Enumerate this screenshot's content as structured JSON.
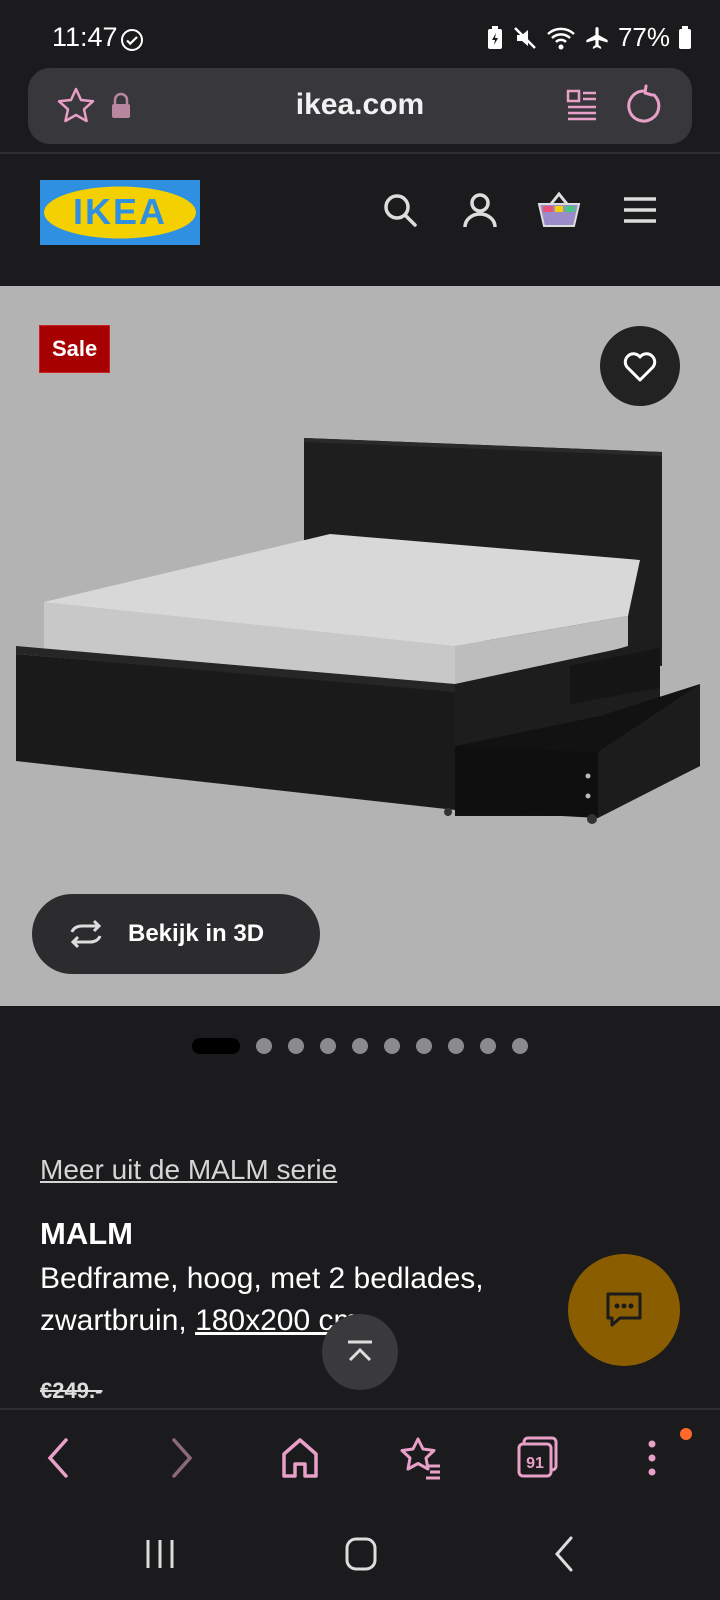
{
  "status_bar": {
    "time": "11:47",
    "battery": "77%"
  },
  "browser": {
    "url": "ikea.com",
    "tab_count": "91"
  },
  "site": {
    "logo_text": "IKEA"
  },
  "product": {
    "sale_badge": "Sale",
    "view_3d_label": "Bekijk in 3D",
    "series_link": "Meer uit de MALM serie",
    "name": "MALM",
    "description": "Bedframe, hoog, met 2 bedlades, zwartbruin, ",
    "size": "180x200 cm",
    "old_price": "€249.-",
    "image_count": 10,
    "active_image": 0
  },
  "colors": {
    "accent_pink": "#e8a0c8",
    "sale_red": "#a60000",
    "chat_fab": "#8a5d00",
    "logo_blue": "#2f8fe0",
    "logo_yellow": "#f4d000"
  },
  "icons": {
    "status": [
      "check-circle-icon",
      "battery-saver-icon",
      "mute-icon",
      "wifi-icon",
      "airplane-icon",
      "battery-icon"
    ],
    "address_bar": [
      "bookmark-star-icon",
      "lock-icon",
      "reader-mode-icon",
      "reload-icon"
    ],
    "header": [
      "search-icon",
      "account-icon",
      "basket-icon",
      "menu-icon"
    ],
    "bottom_bar": [
      "back-icon",
      "forward-icon",
      "home-icon",
      "bookmarks-icon",
      "tabs-icon",
      "more-icon"
    ],
    "system_nav": [
      "recents-icon",
      "home-button-icon",
      "system-back-icon"
    ]
  }
}
